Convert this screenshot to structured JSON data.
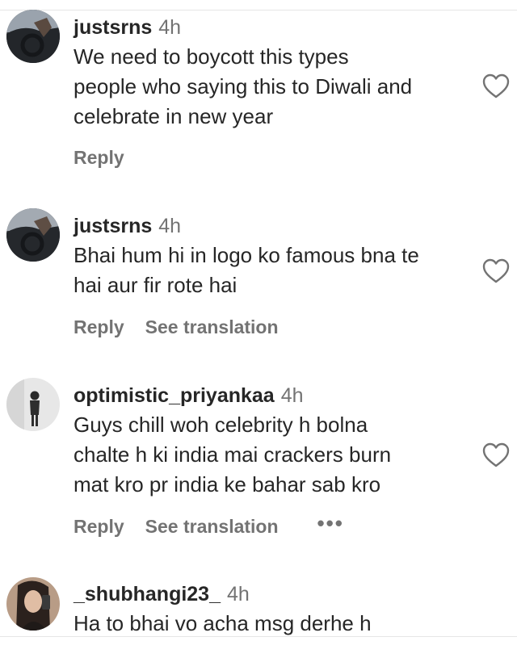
{
  "comments": [
    {
      "username": "justsrns",
      "time": "4h",
      "lines": [
        "We need to boycott this types",
        "people who saying this to Diwali and",
        "celebrate in new year"
      ],
      "reply_label": "Reply"
    },
    {
      "username": "justsrns",
      "time": "4h",
      "lines": [
        "Bhai hum hi in logo ko famous bna te",
        "hai aur fir rote hai"
      ],
      "reply_label": "Reply",
      "see_translation_label": "See translation"
    },
    {
      "username": "optimistic_priyankaa",
      "time": "4h",
      "lines": [
        "Guys chill woh celebrity h bolna",
        "chalte h ki india mai crackers burn",
        "mat kro pr india ke bahar sab kro"
      ],
      "reply_label": "Reply",
      "see_translation_label": "See translation",
      "more_label": "•••"
    },
    {
      "username": "_shubhangi23_",
      "time": "4h",
      "lines": [
        "Ha to bhai vo acha msg derhe h"
      ]
    }
  ]
}
